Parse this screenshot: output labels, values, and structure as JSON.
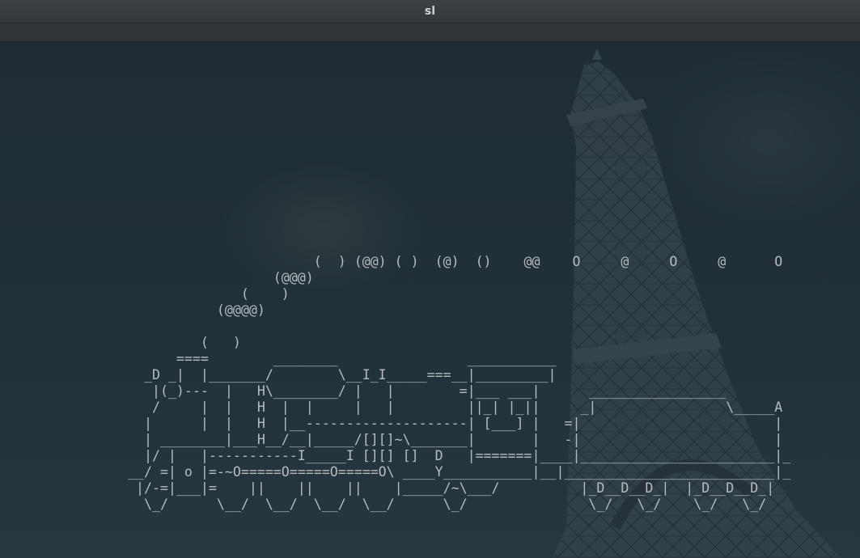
{
  "window": {
    "title": "sl"
  },
  "terminal": {
    "output": "                         (  ) (@@) ( )  (@)  ()    @@    O     @     O     @      O\n                    (@@@)\n                (    )\n             (@@@@)\n\n           (   )\n        ====        ________                ___________\n    _D _|  |_______/        \\__I_I_____===__|_________|\n     |(_)---  |   H\\________/ |   |        =|___ ___|      _________________\n     /     |  |   H  |  |     |   |         ||_| |_||     _|                \\_____A\n    |      |  |   H  |__--------------------| [___] |   =|                        |\n    | ________|___H__/__|_____/[][]~\\_______|       |   -|                        |\n    |/ |   |-----------I_____I [][] []  D   |=======|____|________________________|_\n  __/ =| o |=-~O=====O=====O=====O\\ ____Y___________|__|__________________________|_\n   |/-=|___|=    ||    ||    ||    |_____/~\\___/          |_D__D__D_|  |_D__D__D_|\n    \\_/      \\__/  \\__/  \\__/  \\__/      \\_/               \\_/   \\_/    \\_/   \\_/"
  }
}
